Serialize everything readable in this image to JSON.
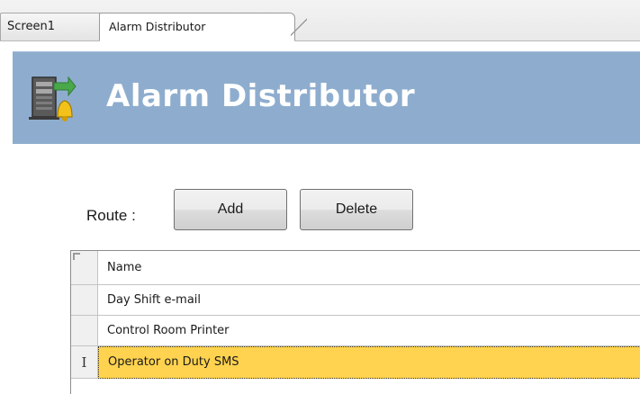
{
  "tabs": [
    {
      "label": "Screen1",
      "active": false
    },
    {
      "label": "Alarm Distributor",
      "active": true
    }
  ],
  "header": {
    "title": "Alarm Distributor",
    "icon": "server-alarm-icon",
    "background_color": "#8eadce"
  },
  "route": {
    "label": "Route :",
    "add_label": "Add",
    "delete_label": "Delete"
  },
  "grid": {
    "columns": [
      "Name"
    ],
    "rows": [
      {
        "name": "Day Shift e-mail",
        "selected": false,
        "row_marker": ""
      },
      {
        "name": "Control Room Printer",
        "selected": false,
        "row_marker": ""
      },
      {
        "name": "Operator on Duty SMS",
        "selected": true,
        "row_marker": "I"
      }
    ],
    "selected_row_color": "#ffd34f"
  }
}
